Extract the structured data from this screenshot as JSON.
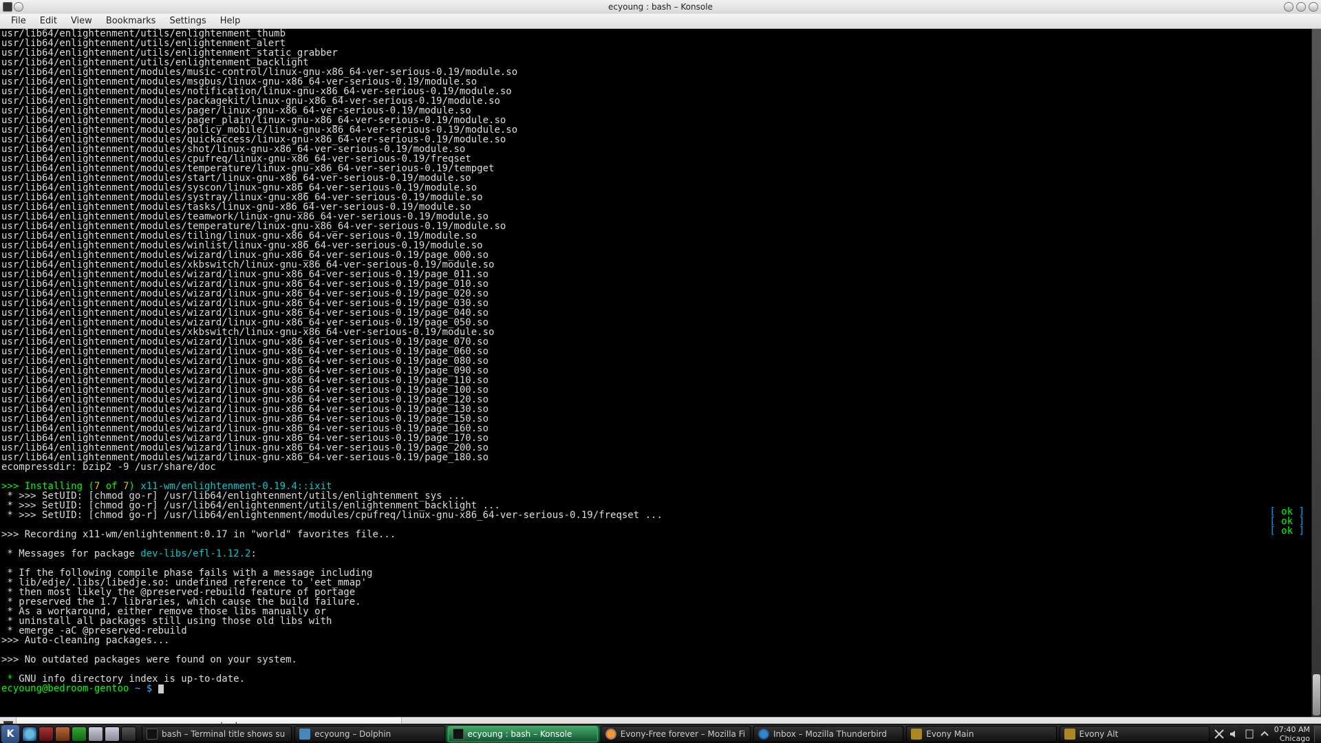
{
  "window": {
    "title": "ecyoung : bash – Konsole"
  },
  "menu": {
    "file": "File",
    "edit": "Edit",
    "view": "View",
    "bookmarks": "Bookmarks",
    "settings": "Settings",
    "help": "Help"
  },
  "terminal": {
    "file_lines": [
      "usr/lib64/enlightenment/utils/enlightenment_thumb",
      "usr/lib64/enlightenment/utils/enlightenment_alert",
      "usr/lib64/enlightenment/utils/enlightenment_static_grabber",
      "usr/lib64/enlightenment/utils/enlightenment_backlight",
      "usr/lib64/enlightenment/modules/music-control/linux-gnu-x86_64-ver-serious-0.19/module.so",
      "usr/lib64/enlightenment/modules/msgbus/linux-gnu-x86_64-ver-serious-0.19/module.so",
      "usr/lib64/enlightenment/modules/notification/linux-gnu-x86_64-ver-serious-0.19/module.so",
      "usr/lib64/enlightenment/modules/packagekit/linux-gnu-x86_64-ver-serious-0.19/module.so",
      "usr/lib64/enlightenment/modules/pager/linux-gnu-x86_64-ver-serious-0.19/module.so",
      "usr/lib64/enlightenment/modules/pager_plain/linux-gnu-x86_64-ver-serious-0.19/module.so",
      "usr/lib64/enlightenment/modules/policy_mobile/linux-gnu-x86_64-ver-serious-0.19/module.so",
      "usr/lib64/enlightenment/modules/quickaccess/linux-gnu-x86_64-ver-serious-0.19/module.so",
      "usr/lib64/enlightenment/modules/shot/linux-gnu-x86_64-ver-serious-0.19/module.so",
      "usr/lib64/enlightenment/modules/cpufreq/linux-gnu-x86_64-ver-serious-0.19/freqset",
      "usr/lib64/enlightenment/modules/temperature/linux-gnu-x86_64-ver-serious-0.19/tempget",
      "usr/lib64/enlightenment/modules/start/linux-gnu-x86_64-ver-serious-0.19/module.so",
      "usr/lib64/enlightenment/modules/syscon/linux-gnu-x86_64-ver-serious-0.19/module.so",
      "usr/lib64/enlightenment/modules/systray/linux-gnu-x86_64-ver-serious-0.19/module.so",
      "usr/lib64/enlightenment/modules/tasks/linux-gnu-x86_64-ver-serious-0.19/module.so",
      "usr/lib64/enlightenment/modules/teamwork/linux-gnu-x86_64-ver-serious-0.19/module.so",
      "usr/lib64/enlightenment/modules/temperature/linux-gnu-x86_64-ver-serious-0.19/module.so",
      "usr/lib64/enlightenment/modules/tiling/linux-gnu-x86_64-ver-serious-0.19/module.so",
      "usr/lib64/enlightenment/modules/winlist/linux-gnu-x86_64-ver-serious-0.19/module.so",
      "usr/lib64/enlightenment/modules/wizard/linux-gnu-x86_64-ver-serious-0.19/page_000.so",
      "usr/lib64/enlightenment/modules/xkbswitch/linux-gnu-x86_64-ver-serious-0.19/module.so",
      "usr/lib64/enlightenment/modules/wizard/linux-gnu-x86_64-ver-serious-0.19/page_011.so",
      "usr/lib64/enlightenment/modules/wizard/linux-gnu-x86_64-ver-serious-0.19/page_010.so",
      "usr/lib64/enlightenment/modules/wizard/linux-gnu-x86_64-ver-serious-0.19/page_020.so",
      "usr/lib64/enlightenment/modules/wizard/linux-gnu-x86_64-ver-serious-0.19/page_030.so",
      "usr/lib64/enlightenment/modules/wizard/linux-gnu-x86_64-ver-serious-0.19/page_040.so",
      "usr/lib64/enlightenment/modules/wizard/linux-gnu-x86_64-ver-serious-0.19/page_050.so",
      "usr/lib64/enlightenment/modules/xkbswitch/linux-gnu-x86_64-ver-serious-0.19/module.so",
      "usr/lib64/enlightenment/modules/wizard/linux-gnu-x86_64-ver-serious-0.19/page_070.so",
      "usr/lib64/enlightenment/modules/wizard/linux-gnu-x86_64-ver-serious-0.19/page_060.so",
      "usr/lib64/enlightenment/modules/wizard/linux-gnu-x86_64-ver-serious-0.19/page_080.so",
      "usr/lib64/enlightenment/modules/wizard/linux-gnu-x86_64-ver-serious-0.19/page_090.so",
      "usr/lib64/enlightenment/modules/wizard/linux-gnu-x86_64-ver-serious-0.19/page_110.so",
      "usr/lib64/enlightenment/modules/wizard/linux-gnu-x86_64-ver-serious-0.19/page_100.so",
      "usr/lib64/enlightenment/modules/wizard/linux-gnu-x86_64-ver-serious-0.19/page_120.so",
      "usr/lib64/enlightenment/modules/wizard/linux-gnu-x86_64-ver-serious-0.19/page_130.so",
      "usr/lib64/enlightenment/modules/wizard/linux-gnu-x86_64-ver-serious-0.19/page_150.so",
      "usr/lib64/enlightenment/modules/wizard/linux-gnu-x86_64-ver-serious-0.19/page_160.so",
      "usr/lib64/enlightenment/modules/wizard/linux-gnu-x86_64-ver-serious-0.19/page_170.so",
      "usr/lib64/enlightenment/modules/wizard/linux-gnu-x86_64-ver-serious-0.19/page_200.so",
      "usr/lib64/enlightenment/modules/wizard/linux-gnu-x86_64-ver-serious-0.19/page_180.so"
    ],
    "ecompress": "ecompressdir: bzip2 -9 /usr/share/doc",
    "install_prefix": ">>> Installing (",
    "install_n": "7",
    "install_of": " of ",
    "install_total": "7",
    "install_close": ") ",
    "install_pkg": "x11-wm/enlightenment-0.19.4::ixit",
    "setuid1": " * >>> SetUID: [chmod go-r] /usr/lib64/enlightenment/utils/enlightenment_sys ...",
    "setuid2": " * >>> SetUID: [chmod go-r] /usr/lib64/enlightenment/utils/enlightenment_backlight ...",
    "setuid3": " * >>> SetUID: [chmod go-r] /usr/lib64/enlightenment/modules/cpufreq/linux-gnu-x86_64-ver-serious-0.19/freqset ...",
    "recording": ">>> Recording x11-wm/enlightenment:0.17 in \"world\" favorites file...",
    "msg_prefix": " * Messages for package ",
    "msg_pkg": "dev-libs/efl-1.12.2",
    "msg_colon": ":",
    "m1": " * If the following compile phase fails with a message including",
    "m2": " * lib/edje/.libs/libedje.so: undefined reference to 'eet_mmap'",
    "m3": " * then most likely the @preserved-rebuild feature of portage",
    "m4": " * preserved the 1.7 libraries, which cause the build failure.",
    "m5": " * As a workaround, either remove those libs manually or",
    "m6": " * uninstall all packages still using those old libs with",
    "m7": " * emerge -aC @preserved-rebuild",
    "autoclean": ">>> Auto-cleaning packages...",
    "nooutdated": ">>> No outdated packages were found on your system.",
    "gnuinfo": " * GNU info directory index is up-to-date.",
    "prompt_user": "ecyoung@bedroom-gentoo",
    "prompt_sep": " ~ $ ",
    "ok": "ok"
  },
  "tab": {
    "label": "ecyoung : bash"
  },
  "taskbar": {
    "items": [
      {
        "label": "bash – Terminal title shows su"
      },
      {
        "label": "ecyoung – Dolphin"
      },
      {
        "label": "ecyoung : bash – Konsole"
      },
      {
        "label": "Evony-Free forever – Mozilla Fi"
      },
      {
        "label": "Inbox – Mozilla Thunderbird"
      },
      {
        "label": "Evony Main"
      },
      {
        "label": "Evony Alt"
      }
    ],
    "clock": {
      "time": "07:40 AM",
      "tz": "Chicago"
    }
  }
}
